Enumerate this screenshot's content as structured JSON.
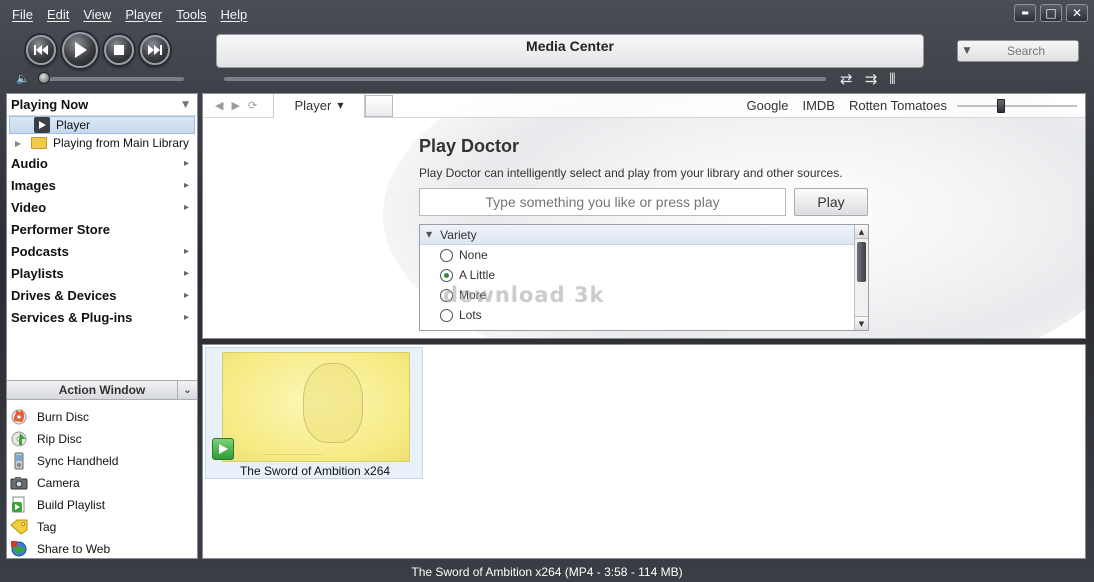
{
  "menu": {
    "file": "File",
    "edit": "Edit",
    "view": "View",
    "player": "Player",
    "tools": "Tools",
    "help": "Help"
  },
  "window_controls": {
    "minimize": "▬",
    "maximize": "□",
    "close": "✕"
  },
  "display": {
    "title": "Media Center"
  },
  "search": {
    "placeholder": "Search"
  },
  "left_panel": {
    "playing_now": "Playing Now",
    "player": "Player",
    "playing_from_library": "Playing from Main Library",
    "categories": [
      "Audio",
      "Images",
      "Video",
      "Performer Store",
      "Podcasts",
      "Playlists",
      "Drives & Devices",
      "Services & Plug-ins"
    ]
  },
  "action_window": {
    "title": "Action Window",
    "items": [
      "Burn Disc",
      "Rip Disc",
      "Sync Handheld",
      "Camera",
      "Build Playlist",
      "Tag",
      "Share to Web"
    ]
  },
  "toolbar": {
    "tab_label": "Player",
    "links": [
      "Google",
      "IMDB",
      "Rotten Tomatoes"
    ]
  },
  "play_doctor": {
    "title": "Play Doctor",
    "description": "Play Doctor can intelligently select and play from your library and other sources.",
    "input_placeholder": "Type something you like or press play",
    "play_button": "Play",
    "variety_label": "Variety",
    "options": [
      "None",
      "A Little",
      "More",
      "Lots"
    ],
    "selected_option": "A Little"
  },
  "watermark": "download 3k",
  "thumbnail": {
    "title": "The Sword of Ambition x264"
  },
  "status_bar": {
    "text": "The Sword of Ambition x264 (MP4 - 3:58 - 114 MB)"
  }
}
